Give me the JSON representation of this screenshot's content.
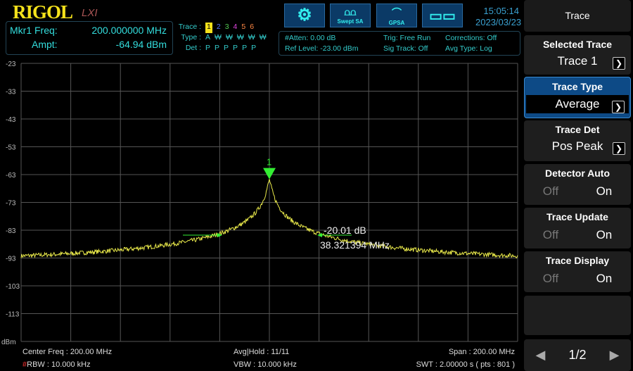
{
  "header": {
    "logo": "RIGOL",
    "lxi": "LXI",
    "time": "15:05:14",
    "date": "2023/03/23"
  },
  "marker": {
    "freq_label": "Mkr1 Freq:",
    "freq_value": "200.000000 MHz",
    "ampt_label": "Ampt:",
    "ampt_value": "-64.94 dBm",
    "marker_num": "1",
    "delta_db": "-20.01 dB",
    "delta_freq": "38.321394 MHz"
  },
  "traces": {
    "trace_label": "Trace :",
    "type_label": "Type :",
    "det_label": "Det :",
    "nums": [
      "1",
      "2",
      "3",
      "4",
      "5",
      "6"
    ],
    "colors": [
      "#f5e21b",
      "#5577ff",
      "#55cc55",
      "#dd44dd",
      "#ff8844",
      "#ff8844"
    ],
    "types": [
      "A",
      "W",
      "W",
      "W",
      "W",
      "W"
    ],
    "dets": [
      "P",
      "P",
      "P",
      "P",
      "P",
      "P"
    ]
  },
  "toolbar": [
    {
      "icon": "gear-icon",
      "label": ""
    },
    {
      "icon": "swept-sa-icon",
      "label": "Swept SA"
    },
    {
      "icon": "gpsa-icon",
      "label": "GPSA"
    },
    {
      "icon": "layout-grid-icon",
      "label": ""
    }
  ],
  "info": {
    "atten": "#Atten: 0.00 dB",
    "ref": "Ref Level: -23.00 dBm",
    "trig": "Trig: Free Run",
    "sigtrack": "Sig Track: Off",
    "corr": "Corrections: Off",
    "avg": "Avg Type: Log"
  },
  "axis": {
    "y_ticks": [
      "-23",
      "-33",
      "-43",
      "-53",
      "-63",
      "-73",
      "-83",
      "-93",
      "-103",
      "-113"
    ],
    "unit": "dBm"
  },
  "footer": {
    "center": "Center Freq : 200.00 MHz",
    "rbw_mark": "#",
    "rbw": "RBW : 10.000 kHz",
    "avg": "Avg|Hold : 11/11",
    "vbw": "VBW : 10.000 kHz",
    "span": "Span : 200.00 MHz",
    "swt": "SWT : 2.00000 s ( pts : 801 )"
  },
  "menu": {
    "title": "Trace",
    "selected_trace": {
      "label": "Selected Trace",
      "value": "Trace 1"
    },
    "trace_type": {
      "label": "Trace Type",
      "value": "Average"
    },
    "trace_det": {
      "label": "Trace Det",
      "value": "Pos Peak"
    },
    "detector_auto": {
      "label": "Detector Auto",
      "off": "Off",
      "on": "On"
    },
    "trace_update": {
      "label": "Trace Update",
      "off": "Off",
      "on": "On"
    },
    "trace_display": {
      "label": "Trace Display",
      "off": "Off",
      "on": "On"
    },
    "page": "1/2"
  },
  "trace_settings": {
    "ref_level_dbm": -23,
    "db_per_div": 10,
    "center_mhz": 200,
    "span_mhz": 200,
    "peak_dbm": -64.94,
    "noise_floor_dbm": -96,
    "points": 801,
    "color": "#e8e84a"
  }
}
